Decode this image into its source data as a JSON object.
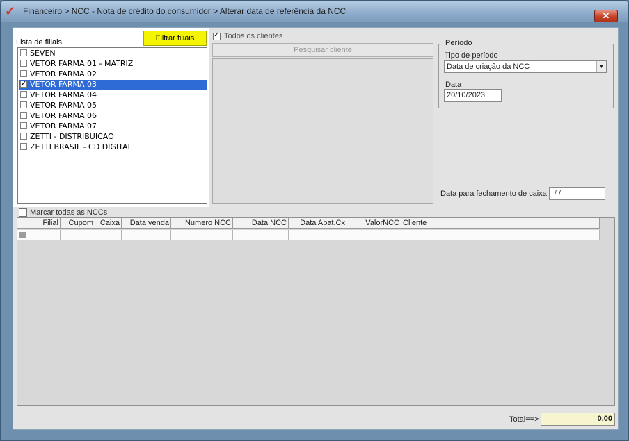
{
  "window": {
    "title": "Financeiro > NCC - Nota de crédito do consumidor > Alterar data de referência da NCC",
    "close_label": "✕"
  },
  "filiais": {
    "label": "Lista de filiais",
    "filter_button": "Filtrar filiais",
    "items": [
      {
        "label": "SEVEN",
        "checked": false,
        "selected": false
      },
      {
        "label": "VETOR FARMA 01 - MATRIZ",
        "checked": false,
        "selected": false
      },
      {
        "label": "VETOR FARMA 02",
        "checked": false,
        "selected": false
      },
      {
        "label": "VETOR FARMA 03",
        "checked": true,
        "selected": true
      },
      {
        "label": "VETOR FARMA 04",
        "checked": false,
        "selected": false
      },
      {
        "label": "VETOR FARMA 05",
        "checked": false,
        "selected": false
      },
      {
        "label": "VETOR FARMA 06",
        "checked": false,
        "selected": false
      },
      {
        "label": "VETOR FARMA 07",
        "checked": false,
        "selected": false
      },
      {
        "label": "ZETTI - DISTRIBUICAO",
        "checked": false,
        "selected": false
      },
      {
        "label": "ZETTI BRASIL - CD DIGITAL",
        "checked": false,
        "selected": false
      }
    ]
  },
  "clientes": {
    "todos_label": "Todos os clientes",
    "todos_checked": true,
    "search_button": "Pesquisar cliente"
  },
  "periodo": {
    "legend": "Período",
    "tipo_label": "Tipo de período",
    "tipo_value": "Data de criação da NCC",
    "data_label": "Data",
    "data_value": "20/10/2023"
  },
  "fechamento": {
    "label": "Data para fechamento de caixa",
    "value": "/  /"
  },
  "grid": {
    "marcar_label": "Marcar todas as NCCs",
    "columns": [
      "Filial",
      "Cupom",
      "Caixa",
      "Data venda",
      "Numero NCC",
      "Data NCC",
      "Data Abat.Cx",
      "ValorNCC",
      "Cliente"
    ]
  },
  "totals": {
    "label": "Total==>",
    "value": "0,00"
  },
  "colors": {
    "filter_button": "#f4f400",
    "selection": "#2f6bd6",
    "total_field": "#f7f5cf"
  }
}
